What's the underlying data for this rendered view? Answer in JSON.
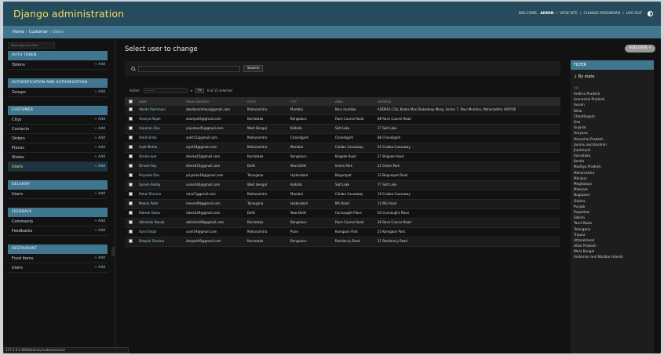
{
  "header": {
    "site_title": "Django administration",
    "welcome": "Welcome,",
    "username": "ADMIN",
    "links": [
      "View site",
      "Change password",
      "Log out"
    ]
  },
  "breadcrumbs": [
    "Home",
    "Customer",
    "Users"
  ],
  "sidebar": {
    "filter_placeholder": "Start typing to filter...",
    "add_label": "Add",
    "modules": [
      {
        "caption": "Auth Token",
        "models": [
          {
            "name": "Tokens",
            "add": true
          }
        ]
      },
      {
        "caption": "Authentication and Authorization",
        "models": [
          {
            "name": "Groups",
            "add": true
          }
        ]
      },
      {
        "caption": "Customer",
        "models": [
          {
            "name": "Citys",
            "add": true
          },
          {
            "name": "Contacts",
            "add": true
          },
          {
            "name": "Orders",
            "add": true
          },
          {
            "name": "Places",
            "add": true
          },
          {
            "name": "States",
            "add": true
          },
          {
            "name": "Users",
            "add": true,
            "current": true
          }
        ]
      },
      {
        "caption": "Delivery",
        "models": [
          {
            "name": "Users",
            "add": true
          }
        ]
      },
      {
        "caption": "Feedback",
        "models": [
          {
            "name": "Comments",
            "add": true
          },
          {
            "name": "Feedbacks",
            "add": true
          }
        ]
      },
      {
        "caption": "Restaurant",
        "models": [
          {
            "name": "Food items",
            "add": true
          },
          {
            "name": "Users",
            "add": true
          }
        ]
      }
    ]
  },
  "status_url": "127.0.0.1:8000/admin/customer/user/",
  "content": {
    "title": "Select user to change",
    "add_button": "ADD USER",
    "search_button": "Search",
    "action_label": "Action:",
    "action_selected": "---------",
    "go_label": "Go",
    "selected_count": "0 of 15 selected",
    "columns": [
      "Name",
      "Email Address",
      "State",
      "City",
      "Area",
      "Address"
    ],
    "rows": [
      [
        "Abeda Rashmani",
        "abedarashmani@gmail.com",
        "Maharashtra",
        "Mumbai",
        "Navi mumbai",
        "ADDRES C16, Badsa Mas Diakadeep Marg, Sector 7, Navi Mumbai, Maharashtra 400706"
      ],
      [
        "Ananya Rajan",
        "ananya45@gmail.com",
        "Karnataka",
        "Bengaluru",
        "Race Course Road",
        "88 Race Course Road"
      ],
      [
        "Anjuman Das",
        "anjuman45@gmail.com",
        "West Bengal",
        "Kolkata",
        "Salt Lake",
        "17 Salt Lake"
      ],
      [
        "Ankit Sinha",
        "ankit11@gmail.com",
        "Maharashtra",
        "Chandigarh",
        "Chandigarh",
        "88 Chandigarh"
      ],
      [
        "Arpit Mehta",
        "arpit18@gmail.com",
        "Maharashtra",
        "Mumbai",
        "Colaba Causeway",
        "55 Colaba Causeway"
      ],
      [
        "Devika Iyer",
        "devika45@gmail.com",
        "Karnataka",
        "Bengaluru",
        "Brigade Road",
        "27 Brigade Road"
      ],
      [
        "Dinesh Roy",
        "dinesh23@gmail.com",
        "Delhi",
        "New Delhi",
        "Green Park",
        "22 Green Park"
      ],
      [
        "Priyanka Das",
        "priyanka18@gmail.com",
        "Telangana",
        "Hyderabad",
        "Begumpet",
        "33 Begumpet Road"
      ],
      [
        "Suresh Reddy",
        "suresh44@gmail.com",
        "West Bengal",
        "Kolkata",
        "Salt Lake",
        "77 Salt Lake"
      ],
      [
        "Rahul Sharma",
        "rahul7@gmail.com",
        "Maharashtra",
        "Mumbai",
        "Colaba Causeway",
        "19 Colaba Causeway"
      ],
      [
        "Meena Patel",
        "meena99@gmail.com",
        "Telangana",
        "Hyderabad",
        "MG Road",
        "15 MG Road"
      ],
      [
        "Rakesh Yadav",
        "rakesh29@gmail.com",
        "Delhi",
        "New Delhi",
        "Connaught Place",
        "63 Connaught Place"
      ],
      [
        "Abhishek Nanda",
        "abhishek98@gmail.com",
        "Karnataka",
        "Bengaluru",
        "Race Course Road",
        "36 Race Course Road"
      ],
      [
        "Sunil Singh",
        "sunil19@gmail.com",
        "Maharashtra",
        "Pune",
        "Koregaon Park",
        "23 Koregaon Park"
      ],
      [
        "Deepak Sharma",
        "deepak99@gmail.com",
        "Karnataka",
        "Bengaluru",
        "Residency Road",
        "21 Residency Road"
      ]
    ]
  },
  "filter": {
    "heading": "Filter",
    "by_state": "↓ By state",
    "subheading": "All",
    "options": [
      "Andhra Pradesh",
      "Arunachal Pradesh",
      "Assam",
      "Bihar",
      "Chhattisgarh",
      "Goa",
      "Gujarat",
      "Haryana",
      "Himachal Pradesh",
      "Jammu and Kashmir",
      "Jharkhand",
      "Karnataka",
      "Kerala",
      "Madhya Pradesh",
      "Maharashtra",
      "Manipur",
      "Meghalaya",
      "Mizoram",
      "Nagaland",
      "Odisha",
      "Punjab",
      "Rajasthan",
      "Sikkim",
      "Tamil Nadu",
      "Telangana",
      "Tripura",
      "Uttarakhand",
      "Uttar Pradesh",
      "West Bengal",
      "Andaman and Nicobar Islands"
    ]
  },
  "colors": {
    "header_bg": "#264b5d",
    "breadcrumb_bg": "#417690",
    "accent_yellow": "#f5dd5d",
    "link_blue": "#9ecae0",
    "page_bg": "#121212"
  }
}
